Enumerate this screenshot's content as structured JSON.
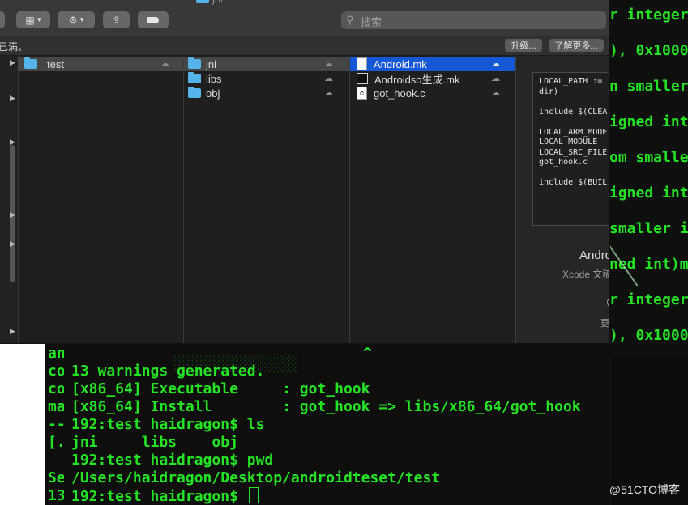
{
  "window": {
    "title": "jni"
  },
  "toolbar": {
    "search_placeholder": "搜索"
  },
  "notice": {
    "text": "已满。",
    "upgrade_label": "升级...",
    "learn_more_label": "了解更多..."
  },
  "columns": {
    "col1": [
      {
        "name": "test"
      }
    ],
    "col2": [
      {
        "name": "jni"
      },
      {
        "name": "libs"
      },
      {
        "name": "obj"
      }
    ],
    "col3": [
      {
        "name": "Android.mk"
      },
      {
        "name": "Androidso生成.mk"
      },
      {
        "name": "got_hook.c"
      }
    ]
  },
  "preview": {
    "code_lines": [
      "LOCAL_PATH :=",
      "dir)",
      "",
      "include $(CLEA",
      "",
      "LOCAL_ARM_MODE",
      "LOCAL_MODULE",
      "LOCAL_SRC_FILE",
      "got_hook.c",
      "",
      "include $(BUIL"
    ],
    "file_title": "Andro",
    "file_kind": "Xcode 文稿",
    "more_label": "更"
  },
  "bg_terminal": {
    "lines": [
      "r integer",
      "), 0x1000",
      "n smaller",
      "igned int",
      "om smaller",
      "igned int",
      "smaller i",
      "ned int)my",
      "r integer",
      "), 0x1000"
    ]
  },
  "terminal": {
    "gutter": [
      "an",
      "co",
      "co",
      "ma",
      "--",
      "[.",
      "",
      "Se",
      "13"
    ],
    "caret_line": "^",
    "lines": [
      "13 warnings generated.",
      "[x86_64] Executable     : got_hook",
      "[x86_64] Install        : got_hook => libs/x86_64/got_hook",
      "192:test haidragon$ ls",
      "jni     libs    obj",
      "192:test haidragon$ pwd",
      "/Users/haidragon/Desktop/androidteset/test",
      "192:test haidragon$ "
    ]
  },
  "watermark": "@51CTO博客"
}
